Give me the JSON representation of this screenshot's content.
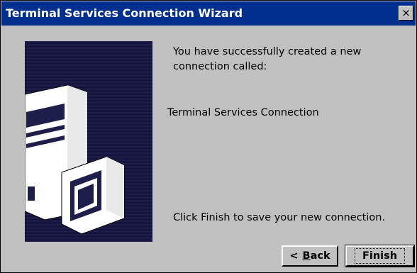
{
  "window": {
    "title": "Terminal Services Connection Wizard",
    "close_label": "×"
  },
  "content": {
    "success_message": "You have successfully created a new connection called:",
    "connection_name": "Terminal Services Connection",
    "finish_prompt": "Click Finish to save your new connection."
  },
  "buttons": {
    "back_prefix": "<",
    "back_label": "Back",
    "back_mnemonic": "B",
    "back_rest": "ack",
    "finish_label": "Finish"
  },
  "art": {
    "icon": "server-and-monitor-illustration",
    "background_color": "#1e1e4a"
  }
}
